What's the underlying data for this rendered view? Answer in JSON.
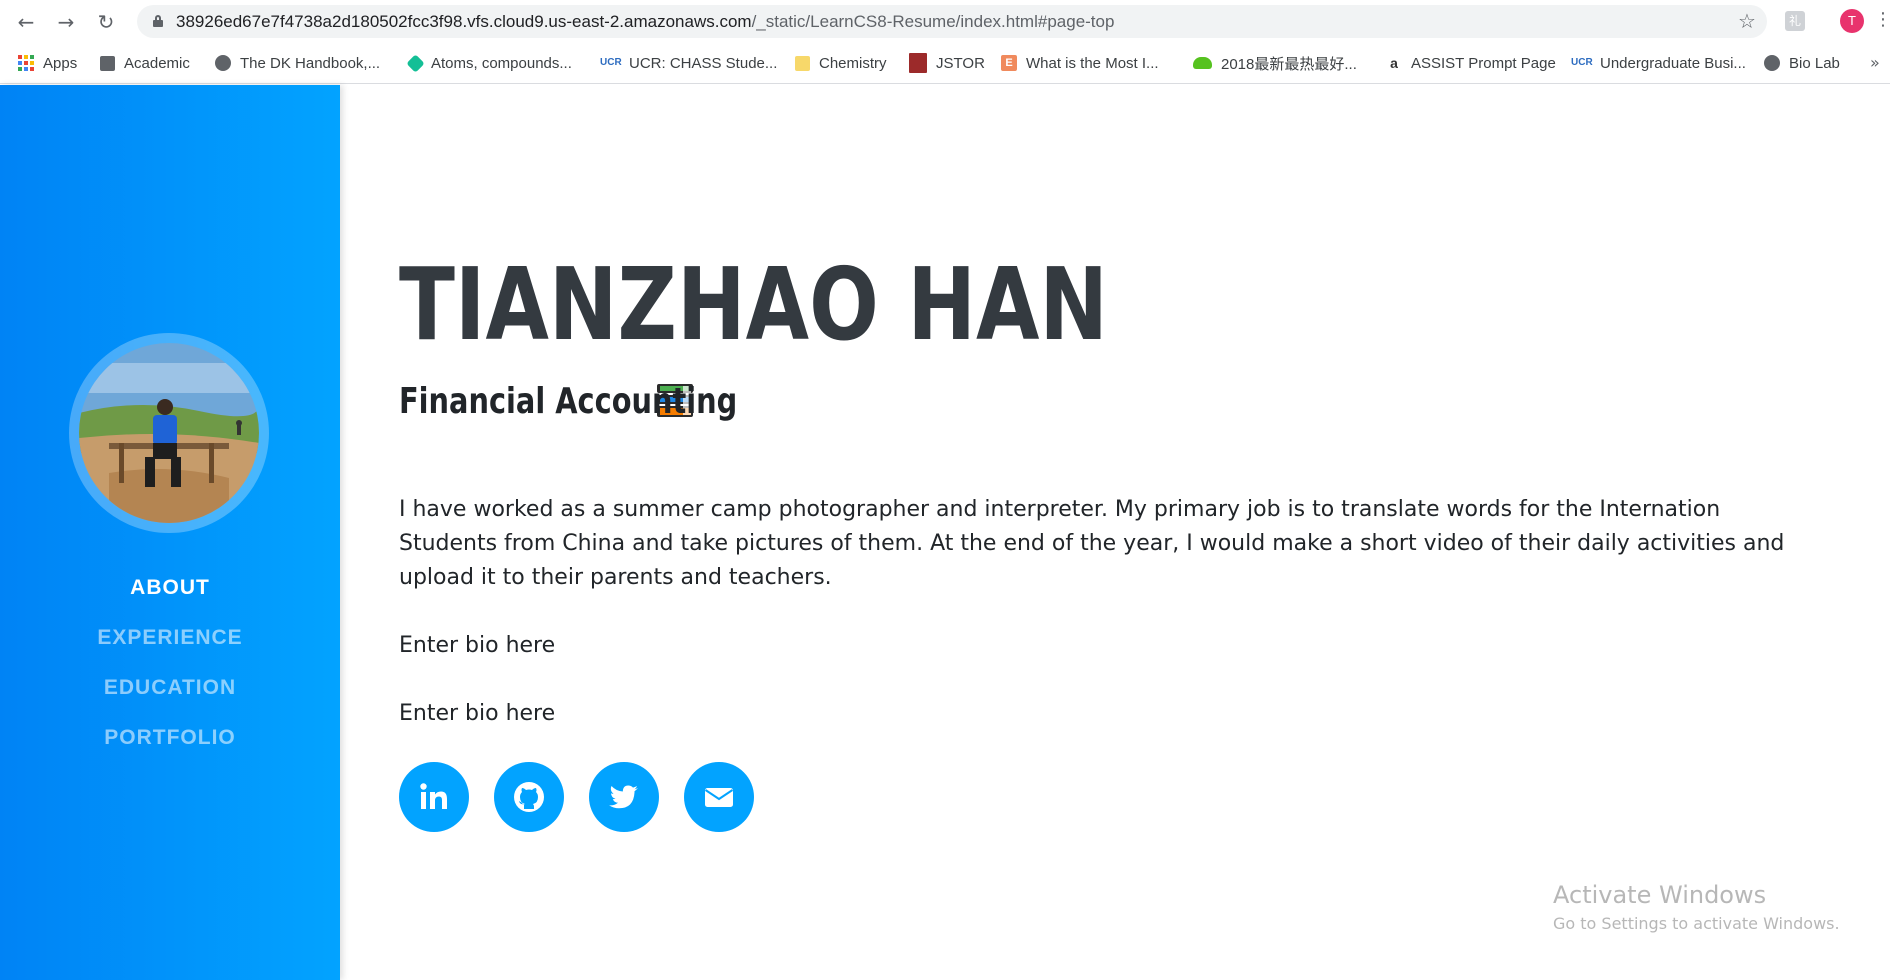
{
  "browser": {
    "url_host": "38926ed67e7f4738a2d180502fcc3f98.vfs.cloud9.us-east-2.amazonaws.com",
    "url_path": "/_static/LearnCS8-Resume/index.html#page-top",
    "profile_initial": "T",
    "extension_label": "礼"
  },
  "bookmarks": [
    {
      "label": "Apps",
      "icon": "apps-grid-icon"
    },
    {
      "label": "Academic",
      "icon": "folder-icon",
      "color": "#5f6368"
    },
    {
      "label": "The DK Handbook,...",
      "icon": "globe-icon",
      "color": "#5f6368"
    },
    {
      "label": "Atoms, compounds...",
      "icon": "khan-icon",
      "color": "#14bf96"
    },
    {
      "label": "UCR: CHASS Stude...",
      "icon": "ucr-icon",
      "color": "#2d6cc0"
    },
    {
      "label": "Chemistry",
      "icon": "folder-icon",
      "color": "#f7d86a"
    },
    {
      "label": "JSTOR",
      "icon": "jstor-icon",
      "color": "#9c2a2a"
    },
    {
      "label": "What is the Most I...",
      "icon": "e-icon",
      "color": "#f08a5d"
    },
    {
      "label": "2018最新最热最好...",
      "icon": "frog-icon",
      "color": "#56c21f"
    },
    {
      "label": "ASSIST Prompt Page",
      "icon": "assist-icon",
      "color": "#333333"
    },
    {
      "label": "Undergraduate Busi...",
      "icon": "ucr-icon",
      "color": "#2d6cc0"
    },
    {
      "label": "Bio Lab",
      "icon": "globe-icon",
      "color": "#5f6368"
    }
  ],
  "bookmarks_more": "»",
  "sidebar": {
    "nav": [
      {
        "label": "ABOUT",
        "active": true
      },
      {
        "label": "EXPERIENCE",
        "active": false
      },
      {
        "label": "EDUCATION",
        "active": false
      },
      {
        "label": "PORTFOLIO",
        "active": false
      }
    ]
  },
  "main": {
    "name": "TIANZHAO HAN",
    "subtitle": "Financial Accounting",
    "bio": [
      "I have worked as a summer camp photographer and interpreter. My primary job is to translate words for the Internation Students from China and take pictures of them. At the end of the year, I would make a short video of their daily activities and upload it to their parents and teachers.",
      "Enter bio here",
      "Enter bio here"
    ],
    "socials": [
      "linkedin-icon",
      "github-icon",
      "twitter-icon",
      "envelope-icon"
    ]
  },
  "watermark": {
    "title": "Activate Windows",
    "subtitle": "Go to Settings to activate Windows."
  },
  "colors": {
    "sidebar_blue": "#0083f5",
    "accent_blue": "#02a3ff",
    "heading": "#343a40"
  }
}
